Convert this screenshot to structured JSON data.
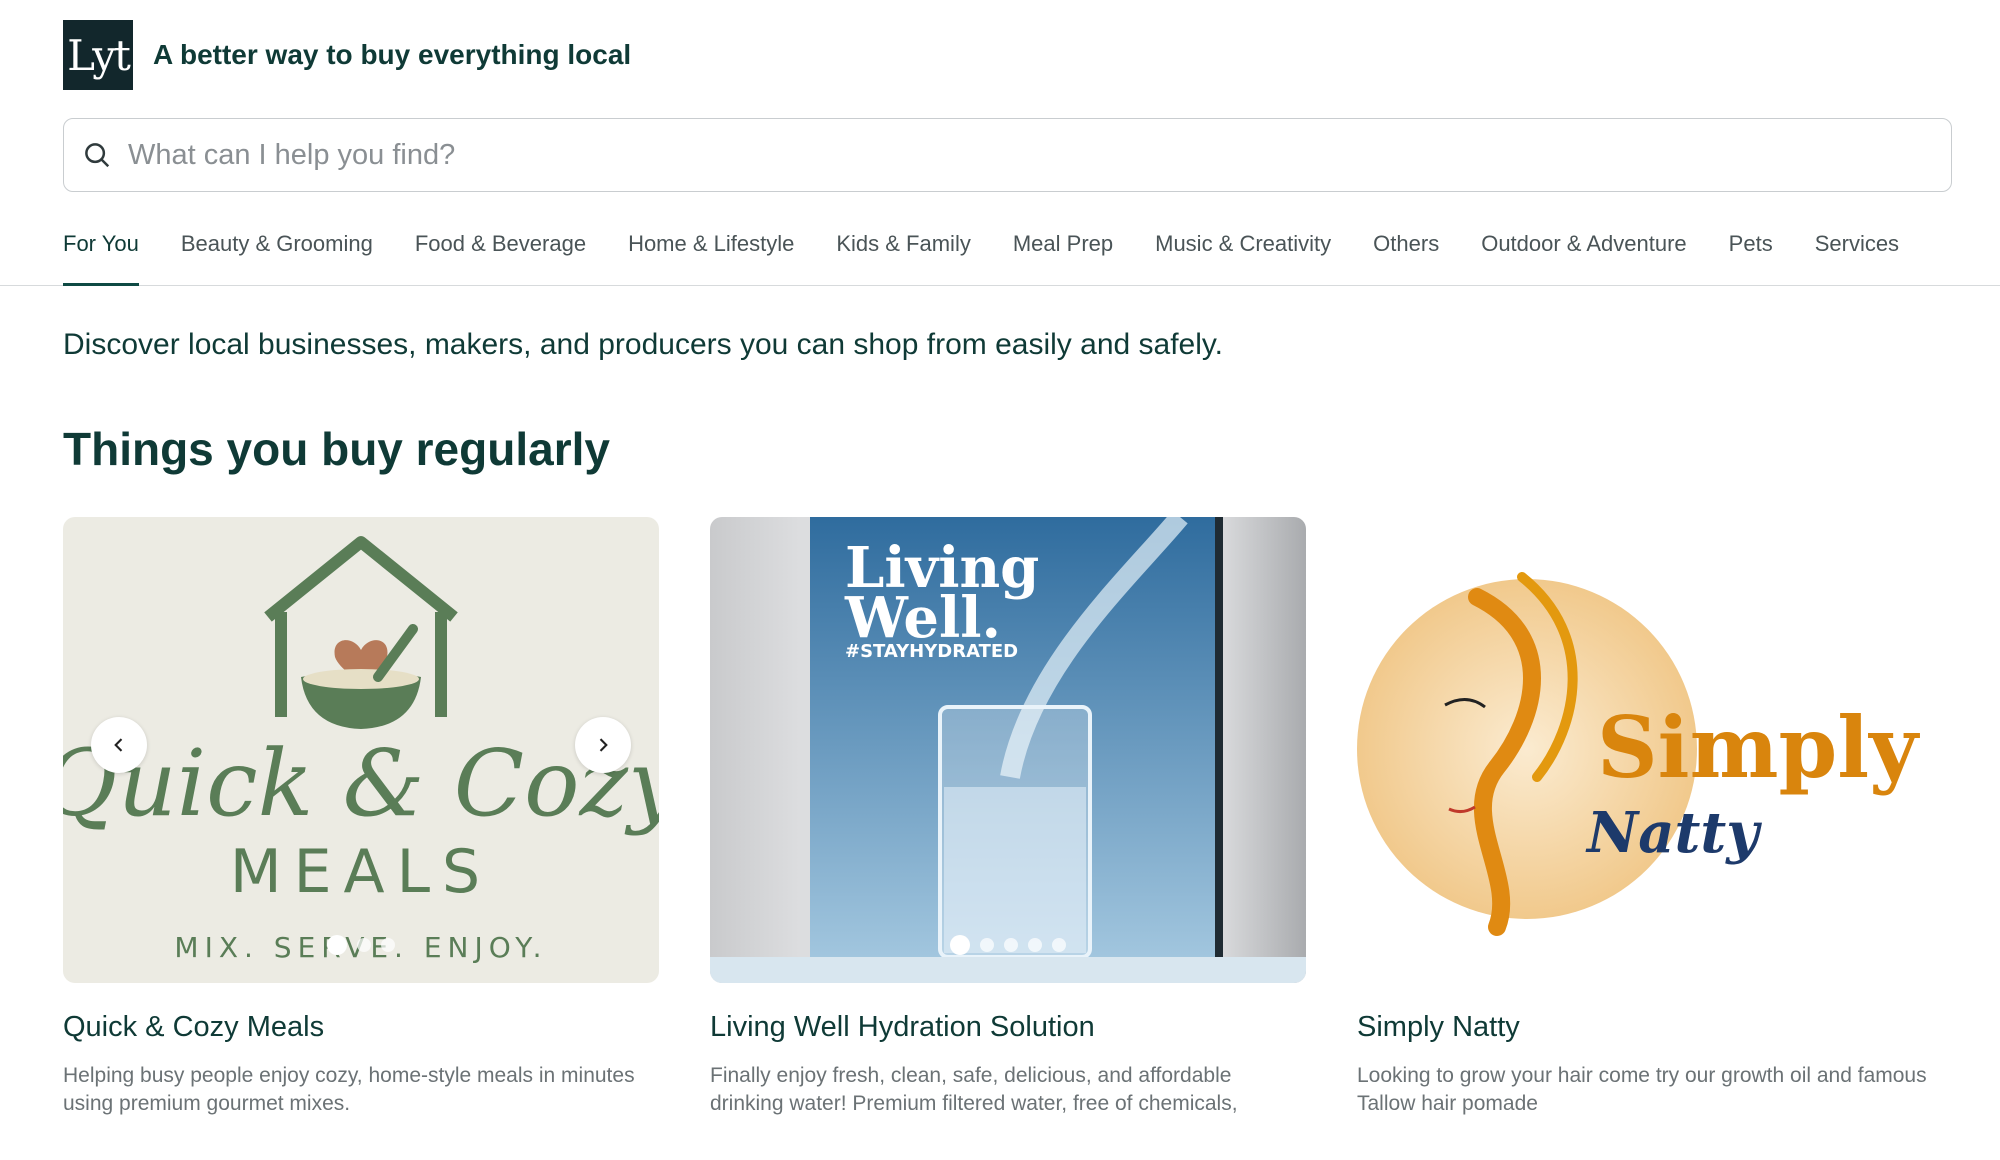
{
  "header": {
    "logo_text": "Lyt",
    "tagline": "A better way to buy everything local"
  },
  "search": {
    "placeholder": "What can I help you find?"
  },
  "tabs": [
    {
      "label": "For You",
      "active": true
    },
    {
      "label": "Beauty & Grooming"
    },
    {
      "label": "Food & Beverage"
    },
    {
      "label": "Home & Lifestyle"
    },
    {
      "label": "Kids & Family"
    },
    {
      "label": "Meal Prep"
    },
    {
      "label": "Music & Creativity"
    },
    {
      "label": "Others"
    },
    {
      "label": "Outdoor & Adventure"
    },
    {
      "label": "Pets"
    },
    {
      "label": "Services"
    }
  ],
  "intro": "Discover local businesses, makers, and producers you can shop from easily and safely.",
  "section_title": "Things you buy regularly",
  "cards": [
    {
      "name": "Quick & Cozy Meals",
      "description": "Helping busy people enjoy cozy, home-style meals in minutes using premium gourmet mixes.",
      "image_text": {
        "line1": "Quick & Cozy",
        "line2": "MEALS",
        "line3": "MIX. SERVE. ENJOY."
      }
    },
    {
      "name": "Living Well Hydration Solution",
      "description": "Finally enjoy fresh, clean, safe, delicious, and affordable drinking water! Premium filtered water, free of chemicals,",
      "image_text": {
        "line1": "Living",
        "line2": "Well.",
        "line3": "#STAYHYDRATED"
      }
    },
    {
      "name": "Simply Natty",
      "description": "Looking to grow your hair come try our growth oil and famous Tallow hair pomade",
      "image_text": {
        "line1": "Simply",
        "line2": "Natty"
      }
    }
  ],
  "colors": {
    "brand_dark": "#12272c",
    "text_primary": "#0f3a36",
    "text_muted": "#6b7275"
  }
}
